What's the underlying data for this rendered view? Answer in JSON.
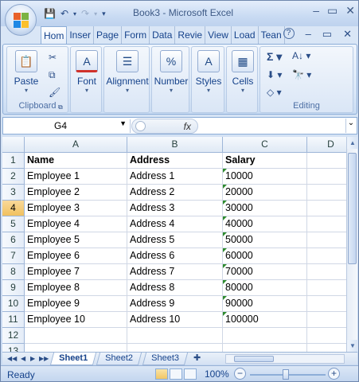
{
  "window": {
    "title": "Book3 - Microsoft Excel",
    "controls": {
      "minimize": "–",
      "restore": "▭",
      "close": "✕"
    }
  },
  "quick_access": {
    "save_icon": "💾",
    "undo_icon": "↶",
    "redo_icon": "↷",
    "customize_icon": "▾"
  },
  "ribbon": {
    "tabs": [
      "Hom",
      "Inser",
      "Page",
      "Form",
      "Data",
      "Revie",
      "View",
      "Load",
      "Tean"
    ],
    "active_tab": 0,
    "help_icon": "?",
    "groups": {
      "clipboard": {
        "label": "Clipboard",
        "paste": "Paste"
      },
      "font": {
        "label": "Font"
      },
      "alignment": {
        "label": "Alignment"
      },
      "number": {
        "label": "Number"
      },
      "styles": {
        "label": "Styles"
      },
      "cells": {
        "label": "Cells"
      },
      "editing": {
        "label": "Editing"
      }
    }
  },
  "formula_bar": {
    "name_box": "G4",
    "fx": "fx",
    "formula": ""
  },
  "grid": {
    "columns": [
      "A",
      "B",
      "C",
      "D"
    ],
    "rows": [
      {
        "n": "1",
        "a": "Name",
        "b": "Address",
        "c": "Salary",
        "header": true
      },
      {
        "n": "2",
        "a": "Employee 1",
        "b": "Address 1",
        "c": "10000"
      },
      {
        "n": "3",
        "a": "Employee 2",
        "b": "Address 2",
        "c": "20000"
      },
      {
        "n": "4",
        "a": "Employee 3",
        "b": "Address 3",
        "c": "30000"
      },
      {
        "n": "5",
        "a": "Employee 4",
        "b": "Address 4",
        "c": "40000"
      },
      {
        "n": "6",
        "a": "Employee 5",
        "b": "Address 5",
        "c": "50000"
      },
      {
        "n": "7",
        "a": "Employee 6",
        "b": "Address 6",
        "c": "60000"
      },
      {
        "n": "8",
        "a": "Employee 7",
        "b": "Address 7",
        "c": "70000"
      },
      {
        "n": "9",
        "a": "Employee 8",
        "b": "Address 8",
        "c": "80000"
      },
      {
        "n": "10",
        "a": "Employee 9",
        "b": "Address 9",
        "c": "90000"
      },
      {
        "n": "11",
        "a": "Employee 10",
        "b": "Address 10",
        "c": "100000"
      },
      {
        "n": "12",
        "a": "",
        "b": "",
        "c": ""
      },
      {
        "n": "13",
        "a": "",
        "b": "",
        "c": ""
      }
    ],
    "selected_row": "4"
  },
  "sheets": {
    "tabs": [
      "Sheet1",
      "Sheet2",
      "Sheet3"
    ],
    "active": 0
  },
  "status_bar": {
    "ready": "Ready",
    "zoom": "100%"
  }
}
